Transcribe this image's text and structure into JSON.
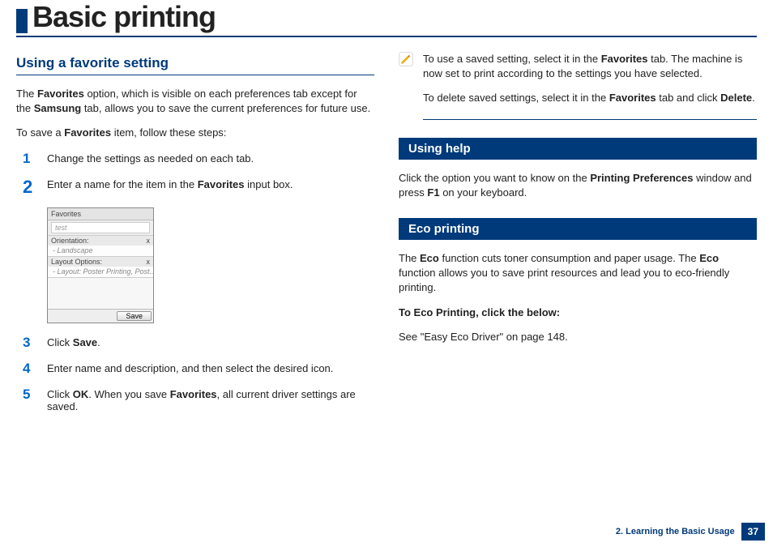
{
  "title": "Basic printing",
  "left": {
    "section_title": "Using a favorite setting",
    "intro_parts": [
      "The ",
      "Favorites",
      " option, which is visible on each preferences tab except for the ",
      "Samsung",
      " tab, allows you to save the current preferences for future use."
    ],
    "tosave_parts": [
      "To save a ",
      "Favorites",
      " item, follow these steps:"
    ],
    "steps": {
      "s1": {
        "num": "1",
        "text": "Change the settings as needed on each tab."
      },
      "s2": {
        "num": "2",
        "parts": [
          "Enter a name for the item in the ",
          "Favorites",
          " input box."
        ]
      },
      "s3": {
        "num": "3",
        "parts": [
          "Click ",
          "Save",
          "."
        ]
      },
      "s4": {
        "num": "4",
        "text": "Enter name and description, and then select the desired icon."
      },
      "s5": {
        "num": "5",
        "parts": [
          "Click ",
          "OK",
          ". When you save ",
          "Favorites",
          ", all current driver settings are saved."
        ]
      }
    },
    "screenshot": {
      "title": "Favorites",
      "input_value": "test",
      "row1_label": "Orientation:",
      "row1_sub": "- Landscape",
      "row2_label": "Layout Options:",
      "row2_sub": "- Layout: Poster Printing, Post...",
      "save_btn": "Save"
    }
  },
  "right": {
    "note_parts1": [
      "To use a saved setting, select it in the ",
      "Favorites",
      " tab. The machine is now set to print according to the settings you have selected."
    ],
    "note_parts2": [
      "To delete saved settings, select it in the  ",
      "Favorites",
      " tab and click ",
      "Delete",
      "."
    ],
    "help_title": "Using help",
    "help_parts": [
      "Click the option you want to know on the ",
      "Printing Preferences",
      " window and press ",
      "F1",
      " on your keyboard."
    ],
    "eco_title": "Eco printing",
    "eco_parts": [
      "The ",
      "Eco",
      " function cuts toner consumption and paper usage. The ",
      "Eco",
      " function allows you to save print resources and lead you to eco-friendly printing."
    ],
    "eco_bold": "To Eco Printing, click the below:",
    "eco_see": "See \"Easy Eco Driver\" on page 148."
  },
  "footer": {
    "chapter": "2. Learning the Basic Usage",
    "page": "37"
  }
}
